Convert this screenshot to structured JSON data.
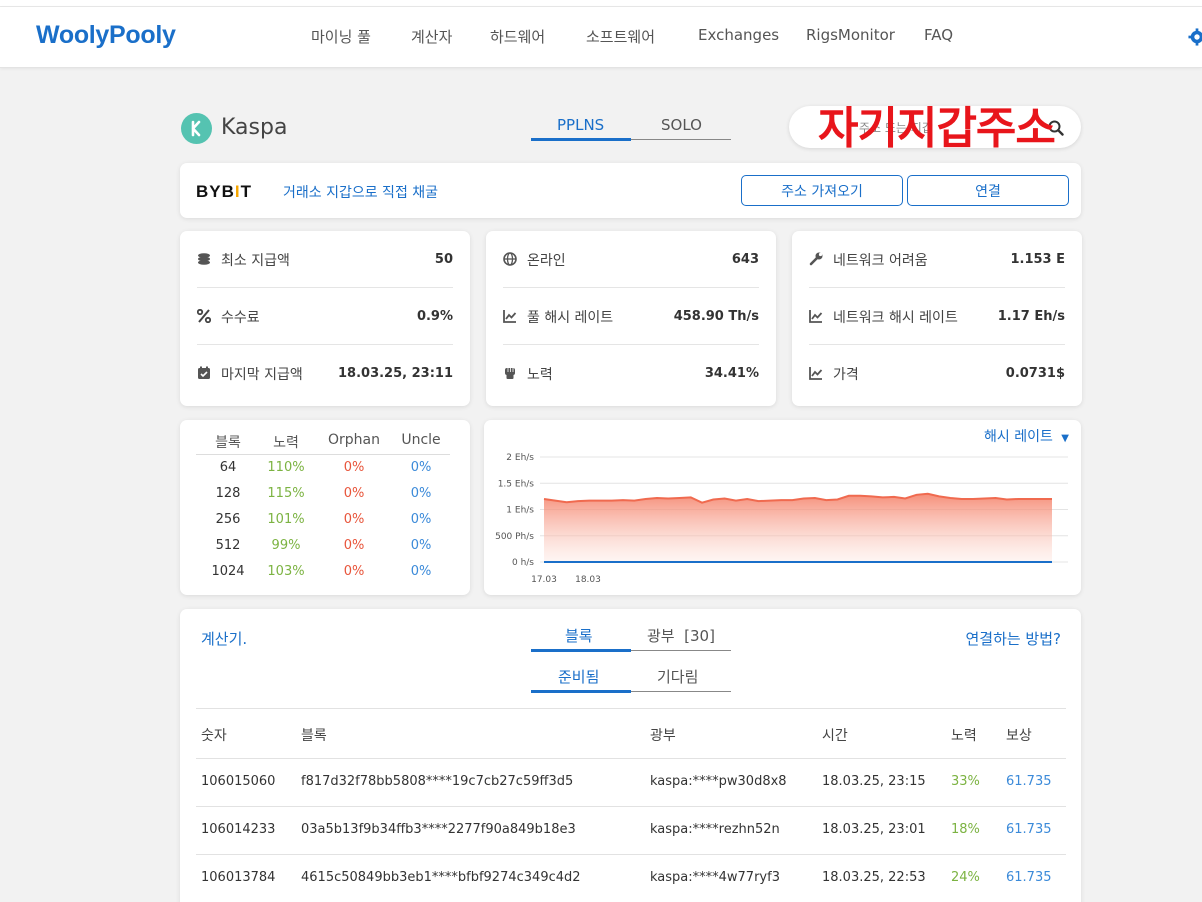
{
  "header": {
    "logo": "WoolyPooly",
    "nav": [
      "마이닝 풀",
      "계산자",
      "하드웨어",
      "소프트웨어",
      "Exchanges",
      "RigsMonitor",
      "FAQ"
    ]
  },
  "coin": {
    "name": "Kaspa",
    "mode_tabs": [
      "PPLNS",
      "SOLO"
    ],
    "active_mode": "PPLNS"
  },
  "search": {
    "placeholder": "주소 또는 지갑",
    "overlay_annotation": "자기지갑주소"
  },
  "exchange_banner": {
    "brand": "BYB",
    "brand_mark": "I",
    "brand_end": "T",
    "link": "거래소 지갑으로 직접 채굴",
    "import_button": "주소 가져오기",
    "connect_button": "연결"
  },
  "stats": [
    [
      {
        "icon": "coins-icon",
        "label": "최소 지급액",
        "value": "50"
      },
      {
        "icon": "percent-icon",
        "label": "수수료",
        "value": "0.9%"
      },
      {
        "icon": "calendar-check-icon",
        "label": "마지막 지급액",
        "value": "18.03.25, 23:11"
      }
    ],
    [
      {
        "icon": "globe-icon",
        "label": "온라인",
        "value": "643"
      },
      {
        "icon": "chart-line-icon",
        "label": "풀 해시 레이트",
        "value": "458.90 Th/s"
      },
      {
        "icon": "fist-icon",
        "label": "노력",
        "value": "34.41%"
      }
    ],
    [
      {
        "icon": "wrench-icon",
        "label": "네트워크 어려움",
        "value": "1.153 E"
      },
      {
        "icon": "chart-line-icon",
        "label": "네트워크 해시 레이트",
        "value": "1.17 Eh/s"
      },
      {
        "icon": "chart-line-icon",
        "label": "가격",
        "value": "0.0731$"
      }
    ]
  ],
  "luck": {
    "headers": [
      "블록",
      "노력",
      "Orphan",
      "Uncle"
    ],
    "rows": [
      [
        "64",
        "110%",
        "0%",
        "0%"
      ],
      [
        "128",
        "115%",
        "0%",
        "0%"
      ],
      [
        "256",
        "101%",
        "0%",
        "0%"
      ],
      [
        "512",
        "99%",
        "0%",
        "0%"
      ],
      [
        "1024",
        "103%",
        "0%",
        "0%"
      ]
    ]
  },
  "chart_data": {
    "type": "area",
    "dropdown_label": "해시 레이트",
    "y_tick_labels": [
      "2 Eh/s",
      "1.5 Eh/s",
      "1 Eh/s",
      "500 Ph/s",
      "0 h/s"
    ],
    "ylim": [
      0,
      2
    ],
    "x_tick_labels": [
      "17.03",
      "18.03"
    ],
    "grid": true,
    "series": [
      {
        "color": "#f06a4f",
        "values": [
          1.2,
          1.17,
          1.14,
          1.16,
          1.17,
          1.17,
          1.17,
          1.18,
          1.17,
          1.2,
          1.22,
          1.21,
          1.22,
          1.23,
          1.13,
          1.19,
          1.21,
          1.17,
          1.2,
          1.16,
          1.17,
          1.18,
          1.18,
          1.21,
          1.22,
          1.18,
          1.19,
          1.26,
          1.26,
          1.25,
          1.23,
          1.24,
          1.21,
          1.28,
          1.3,
          1.25,
          1.22,
          1.2,
          1.2,
          1.21,
          1.22,
          1.19,
          1.2,
          1.2,
          1.2,
          1.2
        ]
      },
      {
        "color": "#1a6fc9",
        "values": [
          0,
          0,
          0,
          0,
          0,
          0,
          0,
          0,
          0,
          0,
          0,
          0,
          0,
          0,
          0,
          0,
          0,
          0,
          0,
          0,
          0,
          0,
          0,
          0,
          0,
          0,
          0,
          0,
          0,
          0,
          0,
          0,
          0,
          0,
          0,
          0,
          0,
          0,
          0,
          0,
          0,
          0,
          0,
          0,
          0,
          0
        ]
      }
    ]
  },
  "blocks": {
    "calc_link": "계산기.",
    "how_link": "연결하는 방법?",
    "tabs": [
      {
        "label": "블록",
        "count": ""
      },
      {
        "label": "광부",
        "count": "[30]"
      }
    ],
    "subtabs": [
      "준비됨",
      "기다림"
    ],
    "columns": [
      "숫자",
      "블록",
      "광부",
      "시간",
      "노력",
      "보상"
    ],
    "rows": [
      [
        "106015060",
        "f817d32f78bb5808****19c7cb27c59ff3d5",
        "kaspa:****pw30d8x8",
        "18.03.25, 23:15",
        "33%",
        "61.735"
      ],
      [
        "106014233",
        "03a5b13f9b34ffb3****2277f90a849b18e3",
        "kaspa:****rezhn52n",
        "18.03.25, 23:01",
        "18%",
        "61.735"
      ],
      [
        "106013784",
        "4615c50849bb3eb1****bfbf9274c349c4d2",
        "kaspa:****4w77ryf3",
        "18.03.25, 22:53",
        "24%",
        "61.735"
      ]
    ]
  }
}
